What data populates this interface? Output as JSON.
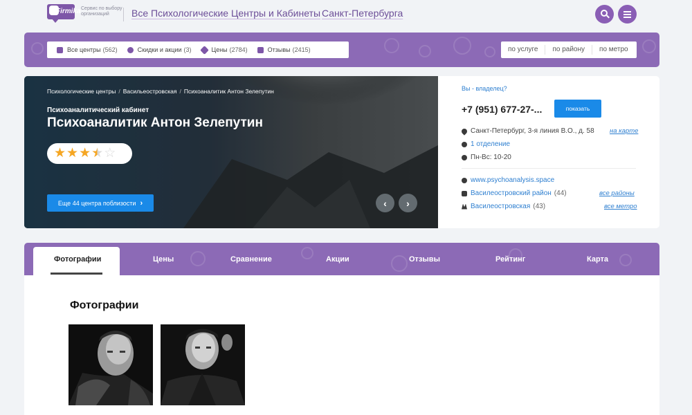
{
  "header": {
    "logo_text": "Firmika",
    "tagline": "Сервис по выбору организаций",
    "title": "Все Психологические Центры и Кабинеты",
    "city": "Санкт-Петербурга"
  },
  "nav": {
    "items": [
      {
        "label": "Все центры",
        "count": "(562)",
        "icon": "home-icon"
      },
      {
        "label": "Скидки и акции",
        "count": "(3)",
        "icon": "percent-icon"
      },
      {
        "label": "Цены",
        "count": "(2784)",
        "icon": "tag-icon"
      },
      {
        "label": "Отзывы",
        "count": "(2415)",
        "icon": "comments-icon"
      }
    ],
    "filters": [
      "по услуге",
      "по району",
      "по метро"
    ]
  },
  "hero": {
    "breadcrumbs": [
      "Психологические центры",
      "Васильеостровская",
      "Психоаналитик Антон Зелепутин"
    ],
    "subtitle": "Психоаналитический кабинет",
    "title": "Психоаналитик Антон Зелепутин",
    "rating": 3.5,
    "rating_max": 5,
    "nearby_label": "Еще 44 центра поблизости"
  },
  "info": {
    "owner_link": "Вы - владелец?",
    "phone": "+7 (951) 677-27-...",
    "show_label": "показать",
    "address": "Санкт-Петербург, 3-я линия В.О., д. 58",
    "map_link": "на карте",
    "branches": "1 отделение",
    "hours": "Пн-Вс: 10-20",
    "website": "www.psychoanalysis.space",
    "district": "Василеостровский район",
    "district_count": "(44)",
    "districts_link": "все районы",
    "metro": "Василеостровская",
    "metro_count": "(43)",
    "metro_link": "все метро"
  },
  "tabs": [
    "Фотографии",
    "Цены",
    "Сравнение",
    "Акции",
    "Отзывы",
    "Рейтинг",
    "Карта"
  ],
  "content": {
    "section_title": "Фотографии"
  },
  "colors": {
    "brand_purple": "#8c6ab6",
    "button_blue": "#1a8ae8",
    "link_blue": "#2e7fd0",
    "star": "#f5a623"
  }
}
